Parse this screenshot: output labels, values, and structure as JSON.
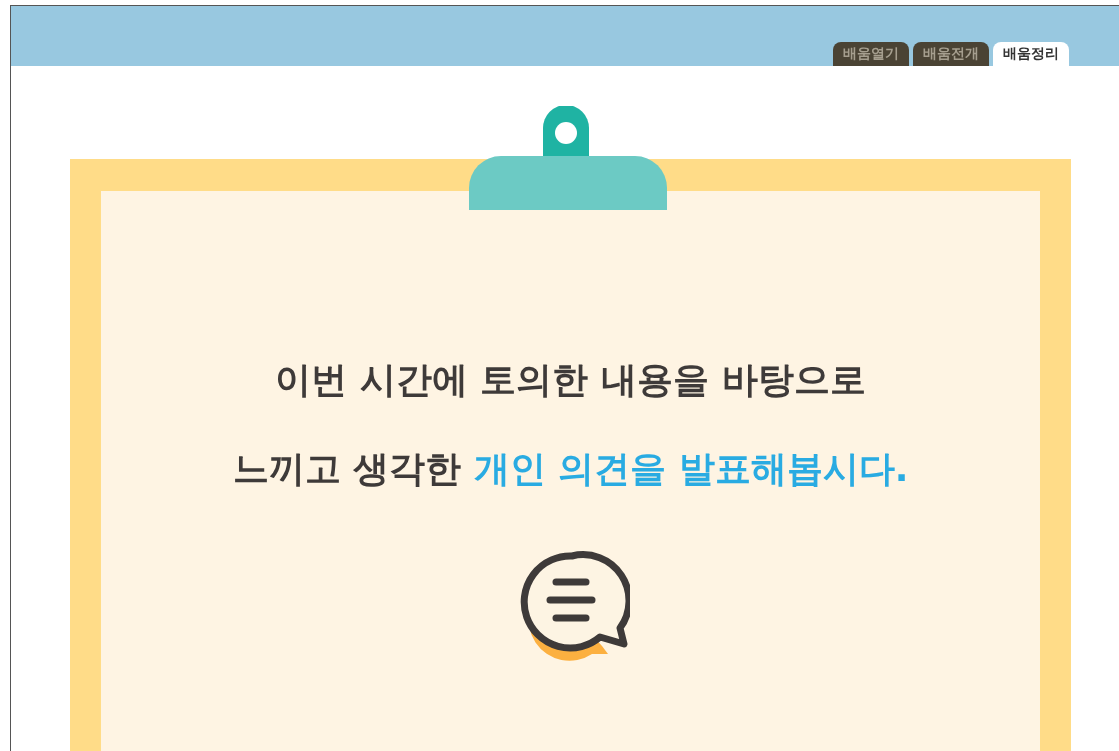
{
  "tabs": [
    {
      "label": "배움열기",
      "selected": false
    },
    {
      "label": "배움전개",
      "selected": false
    },
    {
      "label": "배움정리",
      "selected": true
    }
  ],
  "prompt": {
    "lines": [
      [
        {
          "text": "이번 시간에 토의한 내용을 바탕으로",
          "highlight": false
        }
      ],
      [
        {
          "text": "느끼고 생각한 ",
          "highlight": false
        },
        {
          "text": "개인 의견을 발표해봅시다.",
          "highlight": true
        }
      ]
    ]
  }
}
